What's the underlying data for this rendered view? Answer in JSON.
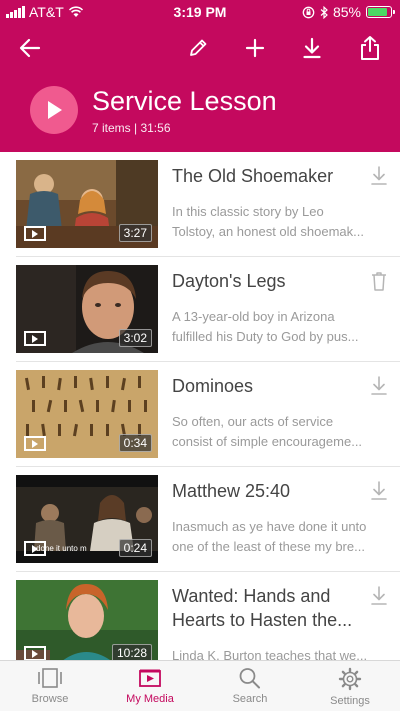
{
  "status": {
    "carrier": "AT&T",
    "time": "3:19 PM",
    "battery": "85%",
    "battery_level": 0.85
  },
  "header": {
    "title": "Service Lesson",
    "subtitle": "7 items | 31:56",
    "accent_color": "#c4095e",
    "icons": [
      "back-arrow-icon",
      "edit-pencil-icon",
      "add-plus-icon",
      "download-icon",
      "share-icon"
    ]
  },
  "videos": [
    {
      "title": "The Old Shoemaker",
      "desc1": "In this classic story by Leo",
      "desc2": "Tolstoy, an honest old shoemak...",
      "duration": "3:27",
      "action": "download-icon"
    },
    {
      "title": "Dayton's Legs",
      "desc1": "A 13-year-old boy in Arizona",
      "desc2": "fulfilled his Duty to God by pus...",
      "duration": "3:02",
      "action": "trash-icon"
    },
    {
      "title": "Dominoes",
      "desc1": "So often, our acts of service",
      "desc2": "consist of simple encourageme...",
      "duration": "0:34",
      "action": "download-icon"
    },
    {
      "title": "Matthew 25:40",
      "desc1": "Inasmuch as ye have done it unto",
      "desc2": "one of the least of these my bre...",
      "duration": "0:24",
      "caption": "done it unto m",
      "action": "download-icon"
    },
    {
      "title_line1": "Wanted: Hands and",
      "title_line2": "Hearts to Hasten the...",
      "desc1": "Linda K. Burton teaches that we...",
      "duration": "10:28",
      "action": "download-icon"
    }
  ],
  "tabs": [
    {
      "label": "Browse",
      "icon": "browse-icon",
      "active": false
    },
    {
      "label": "My Media",
      "icon": "my-media-icon",
      "active": true
    },
    {
      "label": "Search",
      "icon": "search-icon",
      "active": false
    },
    {
      "label": "Settings",
      "icon": "gear-icon",
      "active": false
    }
  ]
}
